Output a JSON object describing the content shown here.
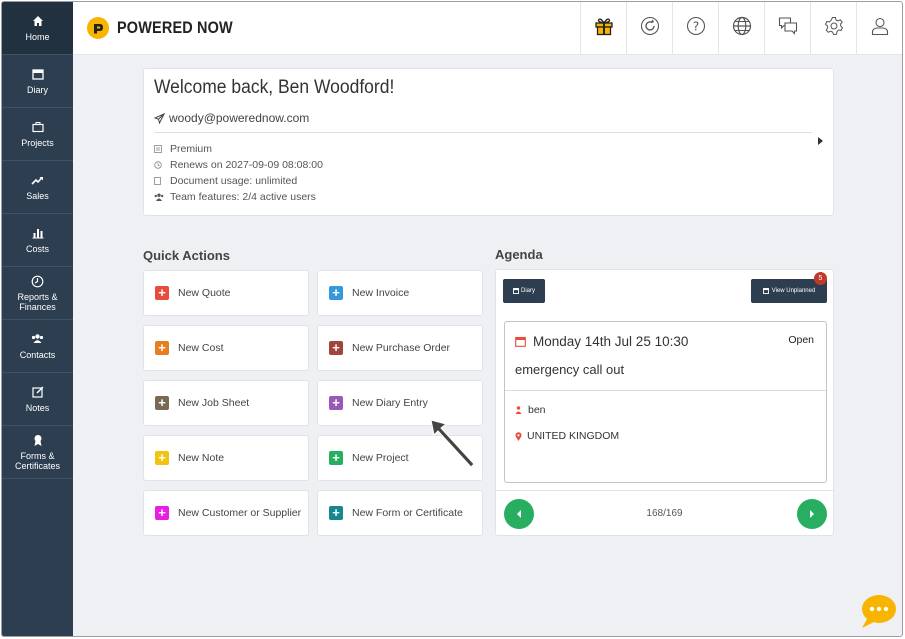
{
  "brand": {
    "name": "POWERED NOW",
    "accent": "#f8b500"
  },
  "sidebar": {
    "items": [
      {
        "label": "Home",
        "icon": "home-icon"
      },
      {
        "label": "Diary",
        "icon": "calendar-icon"
      },
      {
        "label": "Projects",
        "icon": "briefcase-icon"
      },
      {
        "label": "Sales",
        "icon": "trend-up-icon"
      },
      {
        "label": "Costs",
        "icon": "bar-chart-icon"
      },
      {
        "label": "Reports & Finances",
        "icon": "clock-icon"
      },
      {
        "label": "Contacts",
        "icon": "users-icon"
      },
      {
        "label": "Notes",
        "icon": "edit-icon"
      },
      {
        "label": "Forms & Certificates",
        "icon": "certificate-icon"
      }
    ]
  },
  "header": {
    "icons": [
      "gift-icon",
      "refresh-icon",
      "help-icon",
      "globe-icon",
      "chat-icon",
      "gear-icon",
      "user-icon"
    ]
  },
  "welcome": {
    "title": "Welcome back, Ben Woodford!",
    "email": "woody@powerednow.com",
    "plan": "Premium",
    "renews": "Renews on 2027-09-09 08:08:00",
    "document_usage": "Document usage: unlimited",
    "team": "Team features: 2/4 active users"
  },
  "quick_actions": {
    "title": "Quick Actions",
    "items": [
      {
        "label": "New Quote",
        "color": "#e74c3c"
      },
      {
        "label": "New Invoice",
        "color": "#3498db"
      },
      {
        "label": "New Cost",
        "color": "#e67e22"
      },
      {
        "label": "New Purchase Order",
        "color": "#a0453c"
      },
      {
        "label": "New Job Sheet",
        "color": "#7a6a55"
      },
      {
        "label": "New Diary Entry",
        "color": "#9b59b6"
      },
      {
        "label": "New Note",
        "color": "#f1c40f"
      },
      {
        "label": "New Project",
        "color": "#27ae60"
      },
      {
        "label": "New Customer or Supplier",
        "color": "#e91ee0"
      },
      {
        "label": "New Form or Certificate",
        "color": "#16868f"
      }
    ]
  },
  "agenda": {
    "title": "Agenda",
    "diary_button": "Diary",
    "view_unplanned_button": "View Unplanned",
    "unplanned_count": "5",
    "event": {
      "date": "Monday 14th Jul 25 10:30",
      "status": "Open",
      "title": "emergency call out",
      "person": "ben",
      "location": "UNITED KINGDOM"
    },
    "pager": "168/169"
  }
}
